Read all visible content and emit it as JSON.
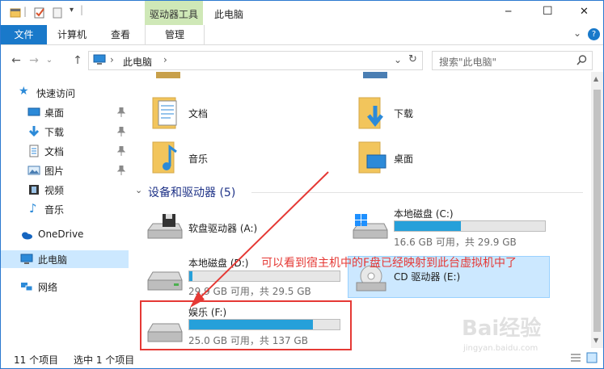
{
  "window": {
    "title": "此电脑",
    "context_tab": "驱动器工具",
    "minimize_glyph": "─",
    "maximize_glyph": "☐",
    "close_glyph": "✕"
  },
  "ribbon": {
    "file_tab": "文件",
    "tabs": [
      "计算机",
      "查看"
    ],
    "manage_tab": "管理",
    "collapse_glyph": "⌄",
    "help_glyph": "?"
  },
  "address": {
    "back_glyph": "←",
    "forward_glyph": "→",
    "recent_glyph": "⌄",
    "up_glyph": "↑",
    "crumb": "此电脑",
    "crumb_sep": "›",
    "dropdown_glyph": "⌄",
    "refresh_glyph": "↻",
    "search_placeholder": "搜索\"此电脑\""
  },
  "nav": {
    "quick_access": "快速访问",
    "items": [
      {
        "label": "桌面",
        "icon": "desktop-icon",
        "pinned": true
      },
      {
        "label": "下载",
        "icon": "download-icon",
        "pinned": true
      },
      {
        "label": "文档",
        "icon": "document-icon",
        "pinned": true
      },
      {
        "label": "图片",
        "icon": "picture-icon",
        "pinned": true
      },
      {
        "label": "视频",
        "icon": "video-icon",
        "pinned": false
      },
      {
        "label": "音乐",
        "icon": "music-icon",
        "pinned": false
      }
    ],
    "onedrive": "OneDrive",
    "this_pc": "此电脑",
    "network": "网络"
  },
  "folders": [
    {
      "label": "文档",
      "icon": "documents-folder-icon"
    },
    {
      "label": "下载",
      "icon": "downloads-folder-icon"
    },
    {
      "label": "音乐",
      "icon": "music-folder-icon"
    },
    {
      "label": "桌面",
      "icon": "desktop-folder-icon"
    }
  ],
  "devices_group": "设备和驱动器 (5)",
  "drives": [
    {
      "name": "软盘驱动器 (A:)",
      "info": "",
      "fill": null,
      "icon": "floppy-drive-icon"
    },
    {
      "name": "本地磁盘 (C:)",
      "info": "16.6 GB 可用，共 29.9 GB",
      "fill": 0.44,
      "icon": "windows-drive-icon"
    },
    {
      "name": "本地磁盘 (D:)",
      "info": "29.9 GB 可用，共 29.5 GB",
      "fill": 0.02,
      "icon": "local-disk-icon"
    },
    {
      "name": "CD 驱动器 (E:)",
      "info": "",
      "fill": null,
      "icon": "cd-drive-icon"
    },
    {
      "name": "娱乐 (F:)",
      "info": "25.0 GB 可用，共 137 GB",
      "fill": 0.82,
      "icon": "network-drive-icon"
    }
  ],
  "annotation": "可以看到宿主机中的F盘已经映射到此台虚拟机中了",
  "status": {
    "count": "11 个项目",
    "selected": "选中 1 个项目"
  },
  "watermark": {
    "brand": "Bai经验",
    "url": "jingyan.baidu.com"
  },
  "colors": {
    "accent": "#1979ca",
    "bar_fill": "#26a0da",
    "selection": "#cce8ff",
    "annotation": "#e53935"
  }
}
